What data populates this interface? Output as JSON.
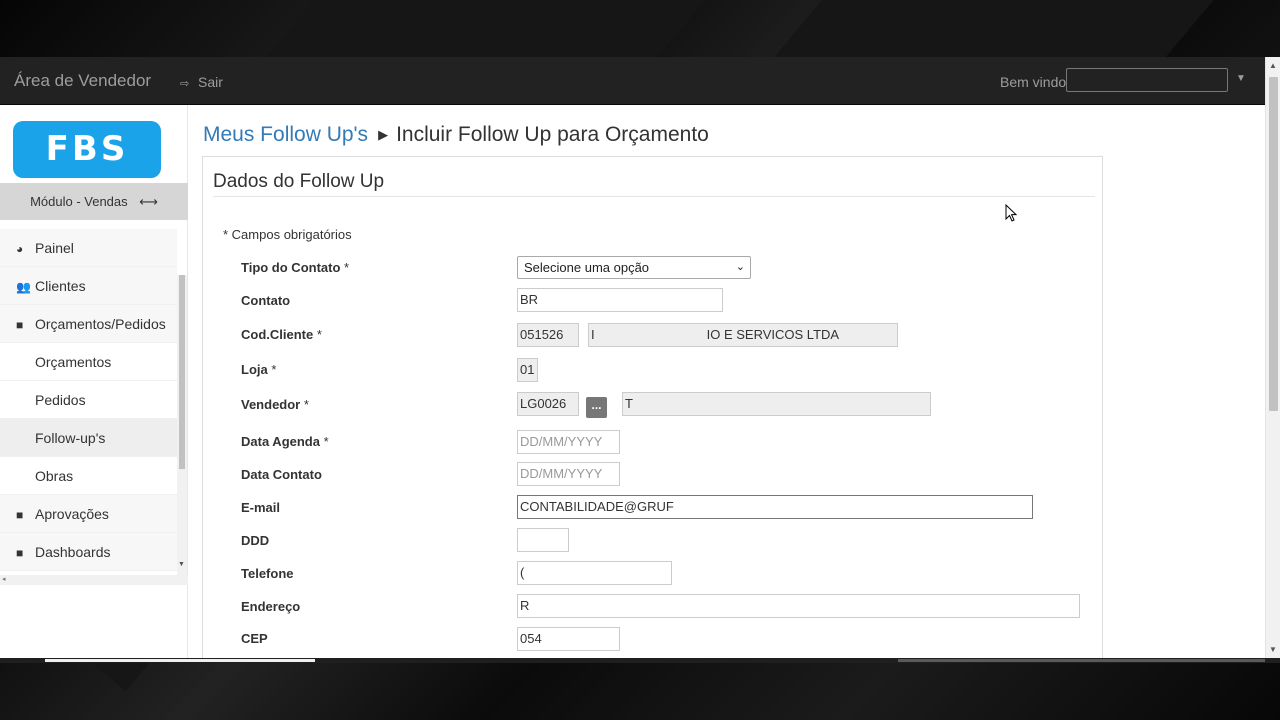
{
  "navbar": {
    "brand": "Área de Vendedor",
    "logout_label": "Sair",
    "welcome_label": "Bem vindo,"
  },
  "sidebar": {
    "logo_text": "FBS",
    "module_label": "Módulo - Vendas",
    "items": [
      {
        "label": "Painel",
        "icon": "dashboard-icon"
      },
      {
        "label": "Clientes",
        "icon": "users-icon"
      },
      {
        "label": "Orçamentos/Pedidos",
        "icon": "folder-icon"
      },
      {
        "label": "Orçamentos"
      },
      {
        "label": "Pedidos"
      },
      {
        "label": "Follow-up's"
      },
      {
        "label": "Obras"
      },
      {
        "label": "Aprovações",
        "icon": "folder-icon"
      },
      {
        "label": "Dashboards",
        "icon": "folder-icon"
      }
    ]
  },
  "breadcrumb": {
    "parent": "Meus Follow Up's",
    "current": "Incluir Follow Up para Orçamento"
  },
  "form": {
    "title": "Dados do Follow Up",
    "required_note": "* Campos obrigatórios",
    "fields": {
      "tipo_contato": {
        "label": "Tipo do Contato",
        "required": "*",
        "value": "Selecione uma opção"
      },
      "contato": {
        "label": "Contato",
        "value": "BR"
      },
      "cod_cliente": {
        "label": "Cod.Cliente",
        "required": "*",
        "code": "051526",
        "name": "IO E SERVICOS LTDA",
        "name_prefix": "I"
      },
      "loja": {
        "label": "Loja",
        "required": "*",
        "value": "01"
      },
      "vendedor": {
        "label": "Vendedor",
        "required": "*",
        "code": "LG0026",
        "lookup_label": "...",
        "name": "T"
      },
      "data_agenda": {
        "label": "Data Agenda",
        "required": "*",
        "placeholder": "DD/MM/YYYY"
      },
      "data_contato": {
        "label": "Data Contato",
        "placeholder": "DD/MM/YYYY"
      },
      "email": {
        "label": "E-mail",
        "value": "CONTABILIDADE@GRUF"
      },
      "ddd": {
        "label": "DDD",
        "value": ""
      },
      "telefone": {
        "label": "Telefone",
        "value": "("
      },
      "endereco": {
        "label": "Endereço",
        "value": "R"
      },
      "cep": {
        "label": "CEP",
        "value": "054"
      }
    }
  }
}
